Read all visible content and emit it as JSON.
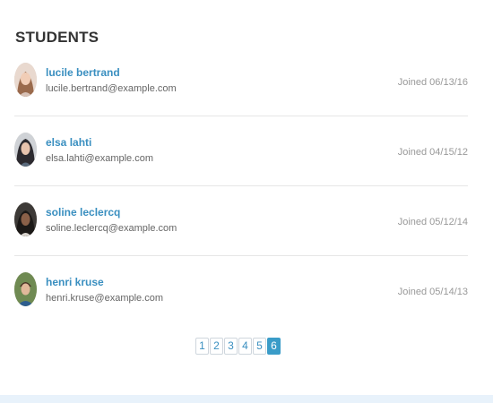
{
  "section": {
    "title": "STUDENTS"
  },
  "students": [
    {
      "name": "lucile bertrand",
      "email": "lucile.bertrand@example.com",
      "joined": "Joined 06/13/16"
    },
    {
      "name": "elsa lahti",
      "email": "elsa.lahti@example.com",
      "joined": "Joined 04/15/12"
    },
    {
      "name": "soline leclercq",
      "email": "soline.leclercq@example.com",
      "joined": "Joined 05/12/14"
    },
    {
      "name": "henri kruse",
      "email": "henri.kruse@example.com",
      "joined": "Joined 05/14/13"
    }
  ],
  "pagination": {
    "pages": [
      "1",
      "2",
      "3",
      "4",
      "5",
      "6"
    ],
    "active": "6"
  },
  "colors": {
    "link": "#3a8fc0",
    "active_page": "#3a9cc8",
    "footer_band": "#e8f2fb"
  }
}
